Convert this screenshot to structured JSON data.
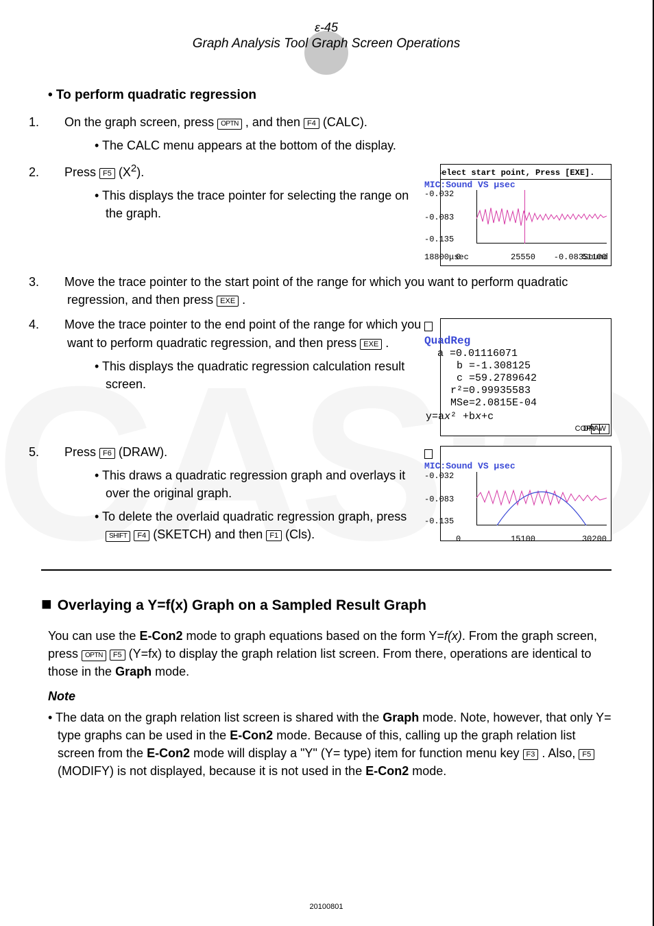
{
  "header": {
    "page_num": "ε-45",
    "chapter": "Graph Analysis Tool Graph Screen Operations"
  },
  "watermark": "CASIO",
  "keys": {
    "optn": "OPTN",
    "f1": "F1",
    "f3": "F3",
    "f4": "F4",
    "f5": "F5",
    "f6": "F6",
    "exe": "EXE",
    "shift": "SHIFT"
  },
  "section1": {
    "title": "• To perform quadratic regression",
    "step1": {
      "num": "1.",
      "part1": "On the graph screen, press ",
      "part2": " , and then ",
      "part3": " (CALC).",
      "sub1": "The CALC menu appears at the bottom of the display."
    },
    "step2": {
      "num": "2.",
      "part1": "Press ",
      "part2": " (X",
      "sup": "2",
      "part3": ").",
      "sub1": "This displays the trace pointer for selecting the range on the graph."
    },
    "step3": {
      "num": "3.",
      "part1": "Move the trace pointer to the start point of the range for which you want to perform quadratic regression, and then press ",
      "part2": " ."
    },
    "step4": {
      "num": "4.",
      "part1": "Move the trace pointer to the end point of the range for which you want to perform quadratic regression, and then press ",
      "part2": " .",
      "sub1": "This displays the quadratic regression calculation result screen."
    },
    "step5": {
      "num": "5.",
      "part1": "Press ",
      "part2": " (DRAW).",
      "sub1": "This draws a quadratic regression graph and overlays it over the original graph.",
      "sub2a": "To delete the overlaid quadratic regression graph, press ",
      "sub2b": " (SKETCH) and then ",
      "sub2c": " (Cls)."
    }
  },
  "lcd1": {
    "topbar": "Select start point, Press [EXE].",
    "mic": "MIC:Sound VS μsec",
    "y_ticks": [
      "-0.032",
      "-0.083",
      "-0.135"
    ],
    "x_ticks": {
      "zero": "0",
      "mid": "25550",
      "right": "51100"
    },
    "bl_left": "18800μsec",
    "bl_right": "-0.083Sound"
  },
  "lcd2": {
    "title": "QuadReg",
    "lines": " a =0.01116071\n b =-1.308125\n c =59.2789642\nr²=0.99935583\nMSe=2.0815E-04",
    "eq_prefix": "y=a",
    "eq_x": "x",
    "eq_suffix": "² +b",
    "eq_x2": "x",
    "eq_tail": "+c",
    "btn_copy": "COPY",
    "btn_draw": "DRAW"
  },
  "lcd3": {
    "mic": "MIC:Sound VS μsec",
    "y_ticks": [
      "-0.032",
      "-0.083",
      "-0.135"
    ],
    "x_ticks": {
      "zero": "0",
      "mid": "15100",
      "right": "30200"
    }
  },
  "section2": {
    "title": "Overlaying a Y=f(x) Graph on a Sampled Result Graph",
    "p1_a": "You can use the ",
    "p1_bold1": "E-Con2",
    "p1_b": " mode to graph equations based on the form Y=",
    "p1_fx": "f(x)",
    "p1_c": ". From the graph screen, press ",
    "p1_d": " (Y=fx) to display the graph relation list screen. From there, operations are identical to those in the ",
    "p1_bold2": "Graph",
    "p1_e": " mode.",
    "note_label": "Note",
    "n1_a": "The data on the graph relation list screen is shared with the ",
    "n1_b1": "Graph",
    "n1_b": " mode. Note, however, that only Y= type graphs can be used in the ",
    "n1_b2": "E-Con2",
    "n1_c": " mode. Because of this, calling up the graph relation list screen from the ",
    "n1_b3": "E-Con2",
    "n1_d": " mode will display a \"Y\" (Y= type) item for function menu key ",
    "n1_e": " . Also, ",
    "n1_f": " (MODIFY) is not displayed, because it is not used in the ",
    "n1_b4": "E-Con2",
    "n1_g": " mode."
  },
  "footer": "20100801",
  "chart_data": [
    {
      "type": "line",
      "title": "Select start point, Press [EXE].",
      "subtitle": "MIC:Sound VS μsec",
      "xlabel": "μsec",
      "ylabel": "Sound",
      "xlim": [
        0,
        51100
      ],
      "ylim": [
        -0.135,
        -0.032
      ],
      "cursor_x": 18800,
      "cursor_y": -0.083,
      "series": [
        {
          "name": "Sound",
          "values_note": "noisy oscillating waveform around -0.083"
        }
      ]
    },
    {
      "type": "table",
      "title": "QuadReg",
      "equation": "y=ax²+bx+c",
      "a": 0.01116071,
      "b": -1.308125,
      "c": 59.2789642,
      "r2": 0.99935583,
      "MSe": 0.00020815
    },
    {
      "type": "line",
      "subtitle": "MIC:Sound VS μsec",
      "xlabel": "μsec",
      "ylabel": "Sound",
      "xlim": [
        0,
        30200
      ],
      "ylim": [
        -0.135,
        -0.032
      ],
      "series": [
        {
          "name": "Sound",
          "values_note": "noisy oscillating waveform"
        },
        {
          "name": "QuadReg fit",
          "values_note": "downward parabola overlay"
        }
      ]
    }
  ]
}
